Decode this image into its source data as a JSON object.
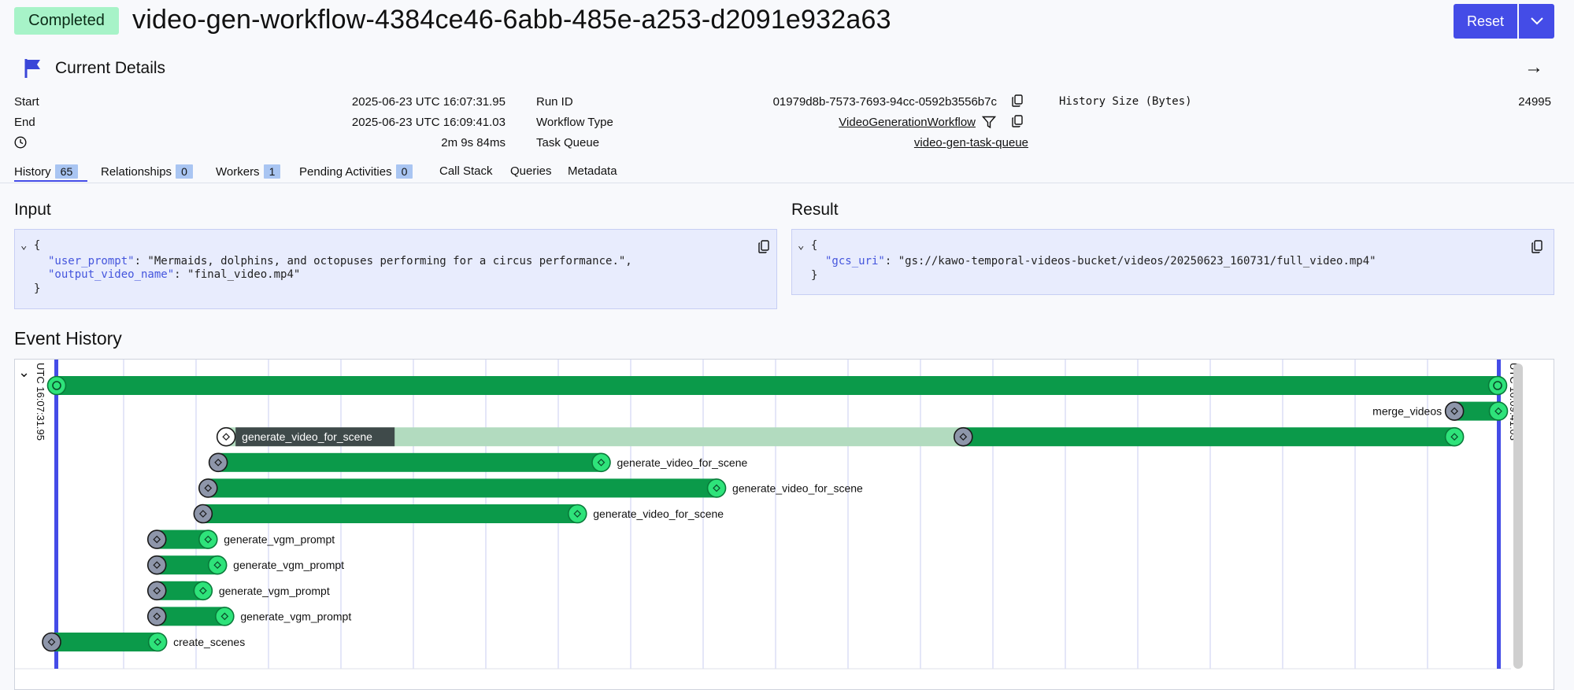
{
  "header": {
    "status": "Completed",
    "workflow_id": "video-gen-workflow-4384ce46-6abb-485e-a253-d2091e932a63",
    "reset_label": "Reset"
  },
  "details": {
    "title": "Current Details",
    "start_label": "Start",
    "start_value": "2025-06-23 UTC 16:07:31.95",
    "end_label": "End",
    "end_value": "2025-06-23 UTC 16:09:41.03",
    "duration_value": "2m 9s 84ms",
    "run_id_label": "Run ID",
    "run_id_value": "01979d8b-7573-7693-94cc-0592b3556b7c",
    "workflow_type_label": "Workflow Type",
    "workflow_type_value": "VideoGenerationWorkflow",
    "task_queue_label": "Task Queue",
    "task_queue_value": "video-gen-task-queue",
    "history_size_label": "History Size (Bytes)",
    "history_size_value": "24995"
  },
  "tabs": [
    {
      "label": "History",
      "count": "65"
    },
    {
      "label": "Relationships",
      "count": "0"
    },
    {
      "label": "Workers",
      "count": "1"
    },
    {
      "label": "Pending Activities",
      "count": "0"
    },
    {
      "label": "Call Stack"
    },
    {
      "label": "Queries"
    },
    {
      "label": "Metadata"
    }
  ],
  "input": {
    "title": "Input",
    "open_brace": "{",
    "close_brace": "}",
    "line1_key": "\"user_prompt\"",
    "line1_val": ": \"Mermaids, dolphins, and octopuses performing for a circus performance.\",",
    "line2_key": "\"output_video_name\"",
    "line2_val": ": \"final_video.mp4\""
  },
  "result": {
    "title": "Result",
    "open_brace": "{",
    "close_brace": "}",
    "line1_key": "\"gcs_uri\"",
    "line1_val": ": \"gs://kawo-temporal-videos-bucket/videos/20250623_160731/full_video.mp4\""
  },
  "event_history": {
    "title": "Event History",
    "start_time_label": "UTC 16:07:31.95",
    "end_time_label": "UTC 16:09:41.03",
    "timeline": [
      {
        "name": "",
        "start": 0.0,
        "scheduled": 0.0,
        "end": 1.0,
        "workflow": true
      },
      {
        "name": "merge_videos",
        "start": 0.9695,
        "scheduled": 0.9695,
        "end": 1.0,
        "label_side": "left"
      },
      {
        "name": "generate_video_for_scene",
        "start": 0.118,
        "scheduled": 0.629,
        "end": 0.9695,
        "label_side": "inside-start",
        "pending": true
      },
      {
        "name": "generate_video_for_scene",
        "start": 0.1125,
        "scheduled": 0.1125,
        "end": 0.378,
        "label_side": "right"
      },
      {
        "name": "generate_video_for_scene",
        "start": 0.1055,
        "scheduled": 0.1055,
        "end": 0.458,
        "label_side": "right"
      },
      {
        "name": "generate_video_for_scene",
        "start": 0.102,
        "scheduled": 0.102,
        "end": 0.3615,
        "label_side": "right"
      },
      {
        "name": "generate_vgm_prompt",
        "start": 0.07,
        "scheduled": 0.07,
        "end": 0.1055,
        "label_side": "right"
      },
      {
        "name": "generate_vgm_prompt",
        "start": 0.07,
        "scheduled": 0.07,
        "end": 0.112,
        "label_side": "right"
      },
      {
        "name": "generate_vgm_prompt",
        "start": 0.07,
        "scheduled": 0.07,
        "end": 0.102,
        "label_side": "right"
      },
      {
        "name": "generate_vgm_prompt",
        "start": 0.07,
        "scheduled": 0.07,
        "end": 0.117,
        "label_side": "right"
      },
      {
        "name": "create_scenes",
        "start": -0.003,
        "scheduled": -0.003,
        "end": 0.0705,
        "label_side": "right"
      }
    ]
  },
  "colors": {
    "accent": "#444ce7",
    "bar": "#0b9a4a",
    "pending_bar": "#b2dbbf",
    "end_node": "#2ee37a",
    "start_node": "#8e96aa",
    "badge": "#a7f3c8"
  }
}
